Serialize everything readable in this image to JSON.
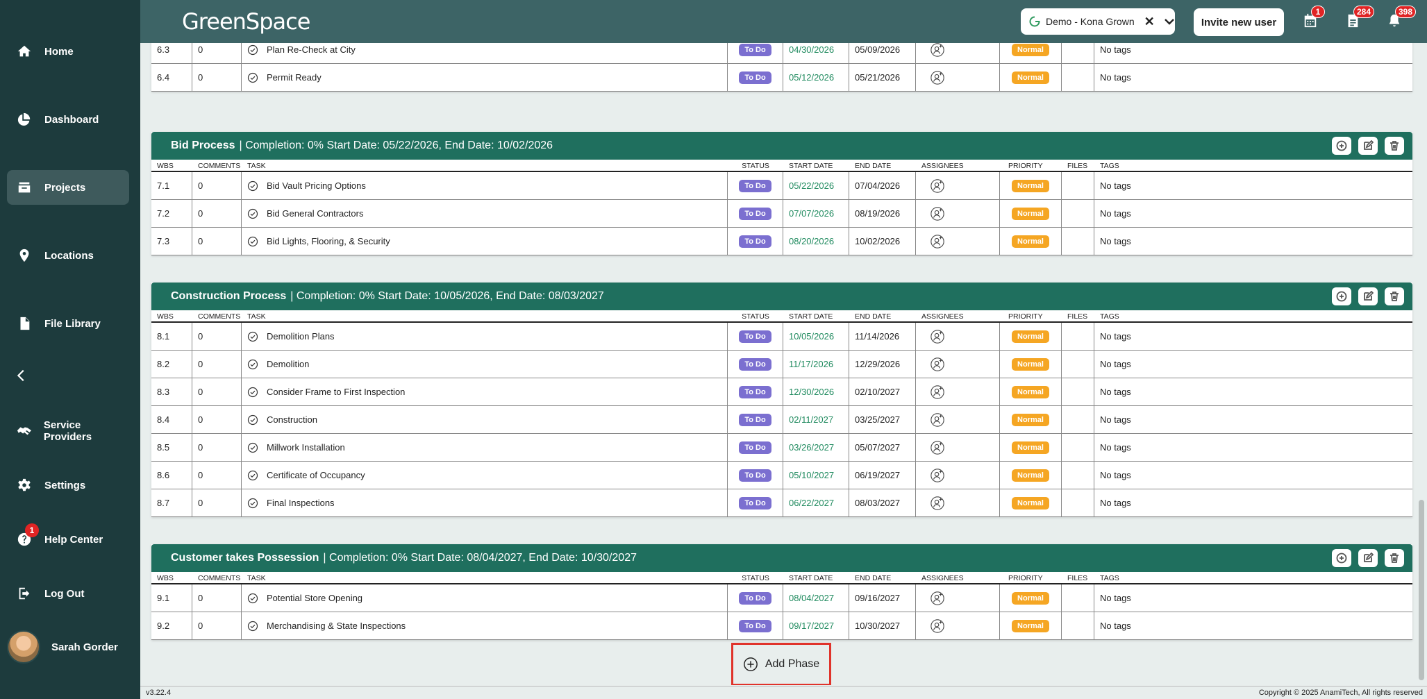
{
  "header": {
    "logo": "GreenSpace",
    "company": "Demo - Kona Grown",
    "invite_label": "Invite new user",
    "badges": {
      "calendar": "1",
      "documents": "284",
      "notifications": "398"
    }
  },
  "sidebar": {
    "items": [
      {
        "label": "Home",
        "icon": "home-icon"
      },
      {
        "label": "Dashboard",
        "icon": "dashboard-icon"
      },
      {
        "label": "Projects",
        "icon": "projects-icon"
      },
      {
        "label": "Locations",
        "icon": "location-pin-icon"
      },
      {
        "label": "File Library",
        "icon": "file-icon"
      },
      {
        "label": "Service Providers",
        "icon": "handshake-icon"
      },
      {
        "label": "Settings",
        "icon": "gear-icon"
      },
      {
        "label": "Help Center",
        "icon": "help-icon"
      },
      {
        "label": "Log Out",
        "icon": "logout-icon"
      }
    ],
    "help_badge": "1",
    "user_name": "Sarah Gorder"
  },
  "columns": {
    "wbs": "WBS",
    "comments": "COMMENTS",
    "task": "TASK",
    "status": "STATUS",
    "start": "START DATE",
    "end": "END DATE",
    "assignees": "ASSIGNEES",
    "priority": "PRIORITY",
    "files": "FILES",
    "tags": "TAGS"
  },
  "partial_rows": [
    {
      "wbs": "6.3",
      "comments": "0",
      "task": "Plan Re-Check at City",
      "status": "To Do",
      "start": "04/30/2026",
      "end": "05/09/2026",
      "priority": "Normal",
      "tags": "No tags"
    },
    {
      "wbs": "6.4",
      "comments": "0",
      "task": "Permit Ready",
      "status": "To Do",
      "start": "05/12/2026",
      "end": "05/21/2026",
      "priority": "Normal",
      "tags": "No tags"
    }
  ],
  "phases": [
    {
      "title": "Bid Process",
      "meta": "| Completion: 0%  Start Date: 05/22/2026, End Date: 10/02/2026",
      "rows": [
        {
          "wbs": "7.1",
          "comments": "0",
          "task": "Bid Vault Pricing Options",
          "status": "To Do",
          "start": "05/22/2026",
          "end": "07/04/2026",
          "priority": "Normal",
          "tags": "No tags"
        },
        {
          "wbs": "7.2",
          "comments": "0",
          "task": "Bid General Contractors",
          "status": "To Do",
          "start": "07/07/2026",
          "end": "08/19/2026",
          "priority": "Normal",
          "tags": "No tags"
        },
        {
          "wbs": "7.3",
          "comments": "0",
          "task": "Bid Lights, Flooring, & Security",
          "status": "To Do",
          "start": "08/20/2026",
          "end": "10/02/2026",
          "priority": "Normal",
          "tags": "No tags"
        }
      ]
    },
    {
      "title": "Construction Process",
      "meta": "| Completion: 0%  Start Date: 10/05/2026, End Date: 08/03/2027",
      "rows": [
        {
          "wbs": "8.1",
          "comments": "0",
          "task": "Demolition Plans",
          "status": "To Do",
          "start": "10/05/2026",
          "end": "11/14/2026",
          "priority": "Normal",
          "tags": "No tags"
        },
        {
          "wbs": "8.2",
          "comments": "0",
          "task": "Demolition",
          "status": "To Do",
          "start": "11/17/2026",
          "end": "12/29/2026",
          "priority": "Normal",
          "tags": "No tags"
        },
        {
          "wbs": "8.3",
          "comments": "0",
          "task": "Consider Frame to First Inspection",
          "status": "To Do",
          "start": "12/30/2026",
          "end": "02/10/2027",
          "priority": "Normal",
          "tags": "No tags"
        },
        {
          "wbs": "8.4",
          "comments": "0",
          "task": "Construction",
          "status": "To Do",
          "start": "02/11/2027",
          "end": "03/25/2027",
          "priority": "Normal",
          "tags": "No tags"
        },
        {
          "wbs": "8.5",
          "comments": "0",
          "task": "Millwork Installation",
          "status": "To Do",
          "start": "03/26/2027",
          "end": "05/07/2027",
          "priority": "Normal",
          "tags": "No tags"
        },
        {
          "wbs": "8.6",
          "comments": "0",
          "task": "Certificate of Occupancy",
          "status": "To Do",
          "start": "05/10/2027",
          "end": "06/19/2027",
          "priority": "Normal",
          "tags": "No tags"
        },
        {
          "wbs": "8.7",
          "comments": "0",
          "task": "Final Inspections",
          "status": "To Do",
          "start": "06/22/2027",
          "end": "08/03/2027",
          "priority": "Normal",
          "tags": "No tags"
        }
      ]
    },
    {
      "title": "Customer takes Possession",
      "meta": "| Completion: 0%  Start Date: 08/04/2027, End Date: 10/30/2027",
      "rows": [
        {
          "wbs": "9.1",
          "comments": "0",
          "task": "Potential Store Opening",
          "status": "To Do",
          "start": "08/04/2027",
          "end": "09/16/2027",
          "priority": "Normal",
          "tags": "No tags"
        },
        {
          "wbs": "9.2",
          "comments": "0",
          "task": "Merchandising & State Inspections",
          "status": "To Do",
          "start": "09/17/2027",
          "end": "10/30/2027",
          "priority": "Normal",
          "tags": "No tags"
        }
      ]
    }
  ],
  "add_phase_label": "Add Phase",
  "footer": {
    "version": "v3.22.4",
    "copyright": "Copyright © 2025 AnamiTech, All rights reserved"
  },
  "colors": {
    "sidebar": "#1d3b3d",
    "header": "#3d6466",
    "phase": "#1f6f5e",
    "todo": "#7b6fd0",
    "normal": "#f5a623",
    "date_green": "#1f8a5e"
  }
}
